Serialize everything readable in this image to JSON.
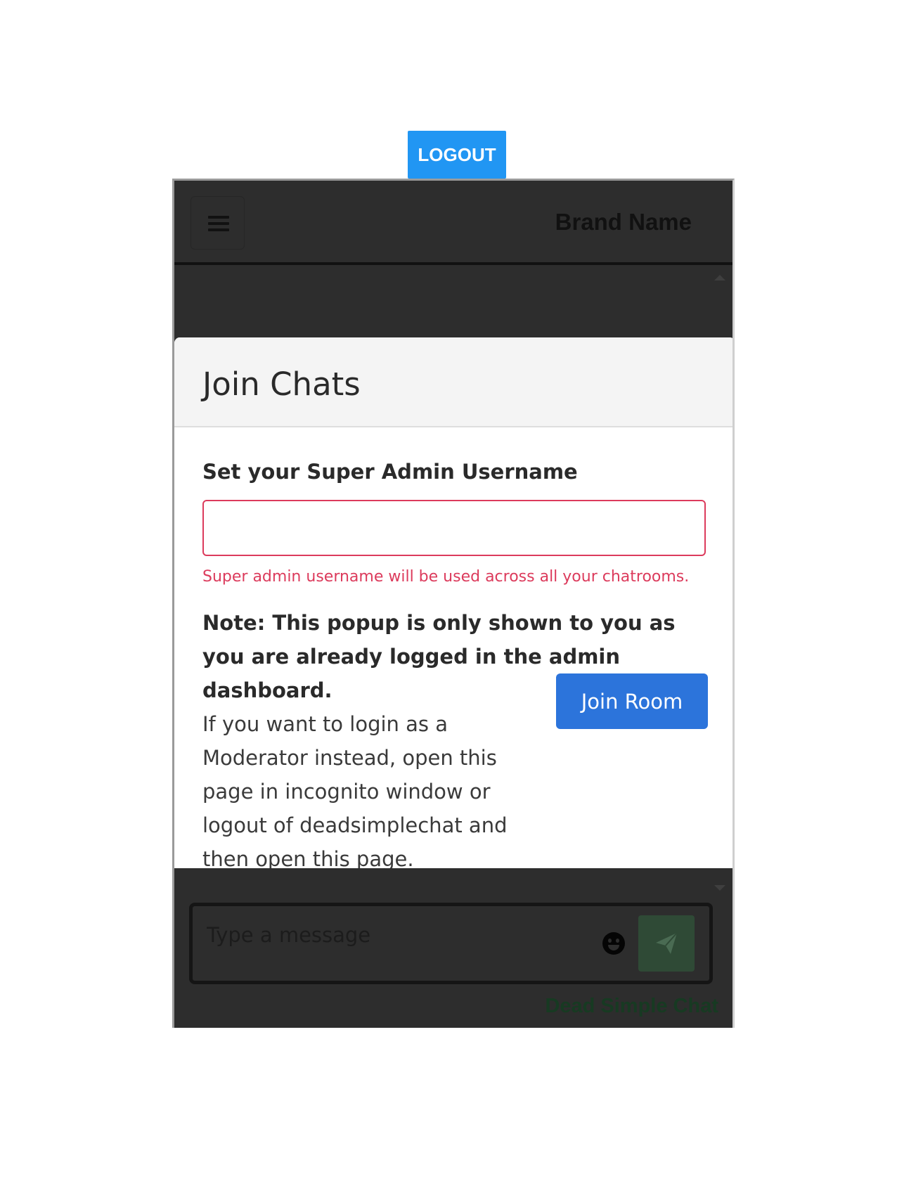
{
  "logout_label": "LOGOUT",
  "navbar": {
    "brand": "Brand Name",
    "menu_icon": "hamburger-icon"
  },
  "modal": {
    "title": "Join Chats",
    "field_label": "Set your Super Admin Username",
    "username_value": "",
    "help_text": "Super admin username will be used across all your chatrooms.",
    "note_strong": "Note: This popup is only shown to you as you are already logged in the admin dashboard.",
    "note_rest": "If you want to login as a Moderator instead, open this page in incognito window or logout of deadsimplechat and then open this page.",
    "join_label": "Join Room"
  },
  "composer": {
    "placeholder": "Type a message",
    "emoji_icon": "smiley-icon",
    "send_icon": "paper-plane-icon"
  },
  "footer": {
    "powered_by": "Dead Simple Chat"
  },
  "colors": {
    "logout_bg": "#2196f3",
    "chat_bg": "#2d2d2d",
    "error_red": "#dc3b5c",
    "join_btn": "#2c74db",
    "send_btn": "#2f4a36",
    "brand_green": "#173a22"
  }
}
